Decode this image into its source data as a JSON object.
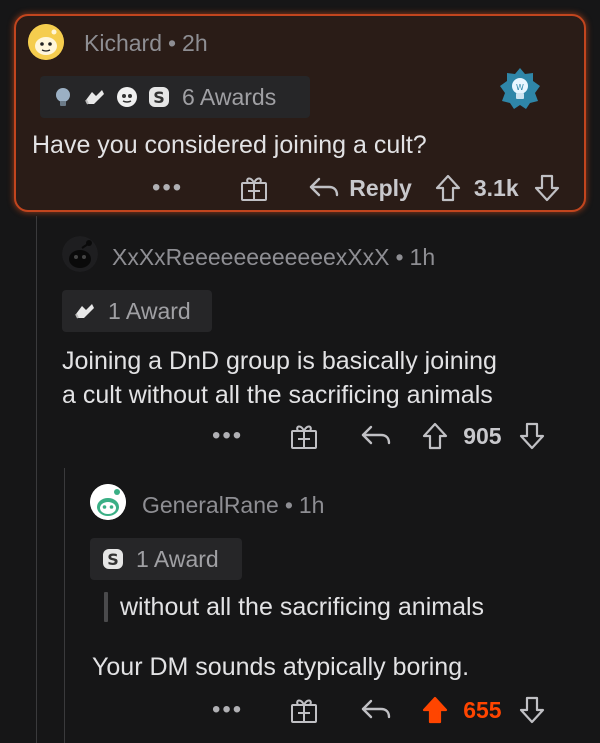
{
  "colors": {
    "background": "#161617",
    "highlight_bg": "#2a1c17",
    "highlight_border": "#c2451e",
    "upvote_active": "#ff4500"
  },
  "comments": [
    {
      "username": "Kichard",
      "separator": "•",
      "time": "2h",
      "award_label": "6 Awards",
      "award_icons": [
        "silver-bulb-icon",
        "wholesome-icon",
        "helpful-icon",
        "silver-s-icon"
      ],
      "body": [
        "Have you considered joining a cult?"
      ],
      "reply_label": "Reply",
      "score": "3.1k",
      "more": "•••",
      "highlighted": true
    },
    {
      "username": "XxXxReeeeeeeeeeeexXxX",
      "separator": "•",
      "time": "1h",
      "award_label": "1 Award",
      "award_icons": [
        "wholesome-icon"
      ],
      "body": [
        "Joining a DnD group is basically joining",
        "a cult without all the sacrificing animals"
      ],
      "score": "905",
      "more": "•••"
    },
    {
      "username": "GeneralRane",
      "separator": "•",
      "time": "1h",
      "award_label": "1 Award",
      "award_icons": [
        "silver-s-icon"
      ],
      "quote": "without all the sacrificing animals",
      "body": [
        "Your DM sounds atypically boring."
      ],
      "score": "655",
      "more": "•••",
      "upvoted": true
    }
  ]
}
